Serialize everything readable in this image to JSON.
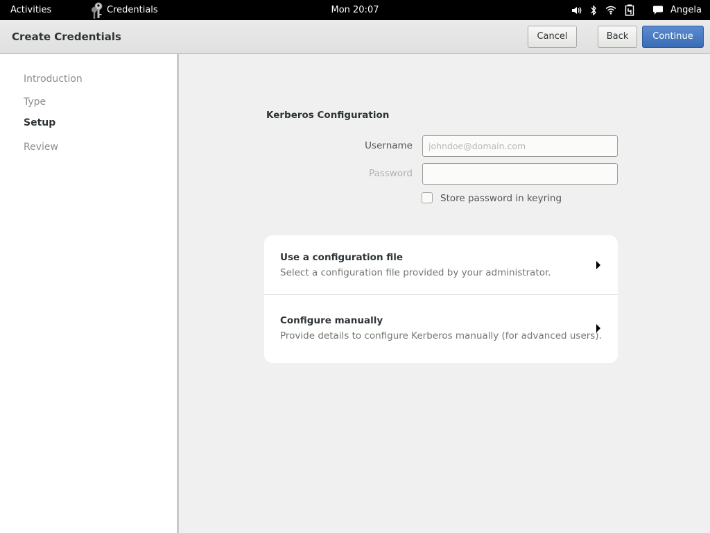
{
  "topbar": {
    "activities": "Activities",
    "app_name": "Credentials",
    "clock": "Mon 20:07",
    "user": "Angela",
    "icons": [
      "volume-icon",
      "bluetooth-icon",
      "wifi-icon",
      "battery-icon",
      "chat-icon"
    ]
  },
  "header": {
    "title": "Create Credentials",
    "cancel": "Cancel",
    "back": "Back",
    "continue": "Continue"
  },
  "sidebar": {
    "steps": [
      {
        "label": "Introduction",
        "active": false
      },
      {
        "label": "Type",
        "active": false
      },
      {
        "label": "Setup",
        "active": true
      },
      {
        "label": "Review",
        "active": false
      }
    ]
  },
  "form": {
    "section_title": "Kerberos Configuration",
    "username_label": "Username",
    "username_placeholder": "johndoe@domain.com",
    "username_value": "",
    "password_label": "Password",
    "password_value": "",
    "store_password_label": "Store password in keyring",
    "store_password_checked": false
  },
  "options": [
    {
      "title": "Use a configuration file",
      "description": "Select a configuration file provided by your administrator."
    },
    {
      "title": "Configure manually",
      "description": "Provide details to configure Kerberos manually (for advanced users)."
    }
  ],
  "colors": {
    "accent": "#4a7cc3",
    "topbar": "#000000",
    "background": "#f0f0f0"
  }
}
